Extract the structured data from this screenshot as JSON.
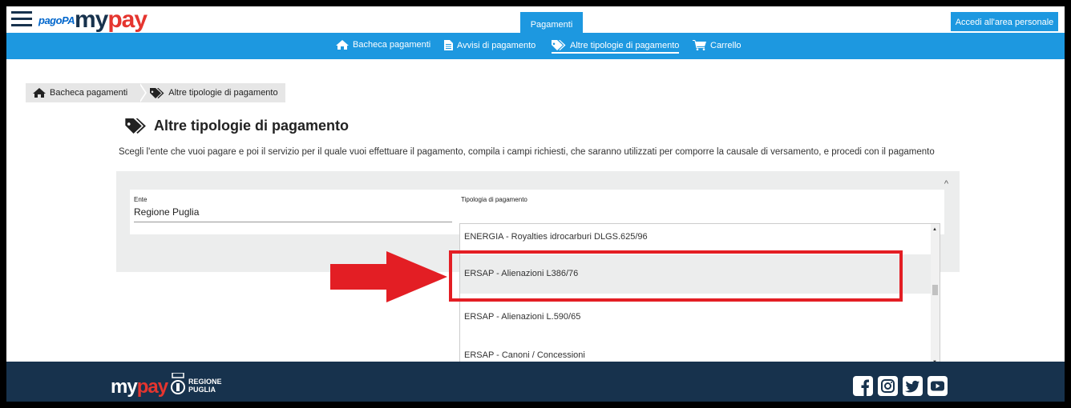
{
  "header": {
    "logo_pagopa": "pagoPA",
    "logo_my": "my",
    "logo_pay": "pay",
    "active_tab": "Pagamenti",
    "login_label": "Accedi all'area personale"
  },
  "nav": {
    "items": [
      {
        "label": "Bacheca pagamenti",
        "icon": "home-icon"
      },
      {
        "label": "Avvisi di pagamento",
        "icon": "document-icon"
      },
      {
        "label": "Altre tipologie di pagamento",
        "icon": "tags-icon",
        "active": true
      },
      {
        "label": "Carrello",
        "icon": "cart-icon"
      }
    ]
  },
  "breadcrumb": {
    "items": [
      {
        "label": "Bacheca pagamenti",
        "icon": "home-icon"
      },
      {
        "label": "Altre tipologie di pagamento",
        "icon": "tags-icon"
      }
    ]
  },
  "page": {
    "title": "Altre tipologie di pagamento",
    "description": "Scegli l'ente che vuoi pagare e poi il servizio per il quale vuoi effettuare il pagamento, compila i campi richiesti, che saranno utilizzati per comporre la causale di versamento, e procedi con il pagamento"
  },
  "form": {
    "ente_label": "Ente",
    "ente_value": "Regione Puglia",
    "tipologia_label": "Tipologia di pagamento"
  },
  "dropdown": {
    "options": [
      "ENERGIA - Royalties idrocarburi DLGS.625/96",
      "ERSAP - Alienazioni L386/76",
      "ERSAP - Alienazioni L.590/65",
      "ERSAP - Canoni / Concessioni"
    ],
    "highlighted_index": 1
  },
  "footer": {
    "logo_my": "my",
    "logo_pay": "pay",
    "regione_line1": "REGIONE",
    "regione_line2": "PUGLIA",
    "social": [
      "facebook-icon",
      "instagram-icon",
      "twitter-icon",
      "youtube-icon"
    ]
  },
  "colors": {
    "primary_blue": "#1d98e0",
    "dark_navy": "#17324d",
    "brand_red": "#e5352f",
    "annotation_red": "#e31e24"
  }
}
